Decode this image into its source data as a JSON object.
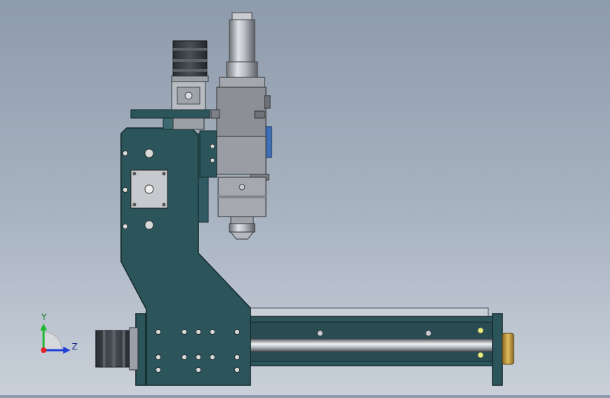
{
  "view": {
    "background_top": "#8e9bab",
    "background_bottom": "#c9d0d9"
  },
  "triad": {
    "y_label": "Y",
    "z_label": "Z",
    "x_color": "#e8242a",
    "y_color": "#1fb832",
    "z_color": "#1f3fd8"
  },
  "parts": {
    "frame_color": "#2c555b",
    "head_color": "#8c9096",
    "bolt_color": "#d8d8d8",
    "motor_color": "#3a3f44",
    "rail_color": "#cfd3d8",
    "accent_blue": "#3c6fb8",
    "accent_gold": "#c49a3c"
  }
}
